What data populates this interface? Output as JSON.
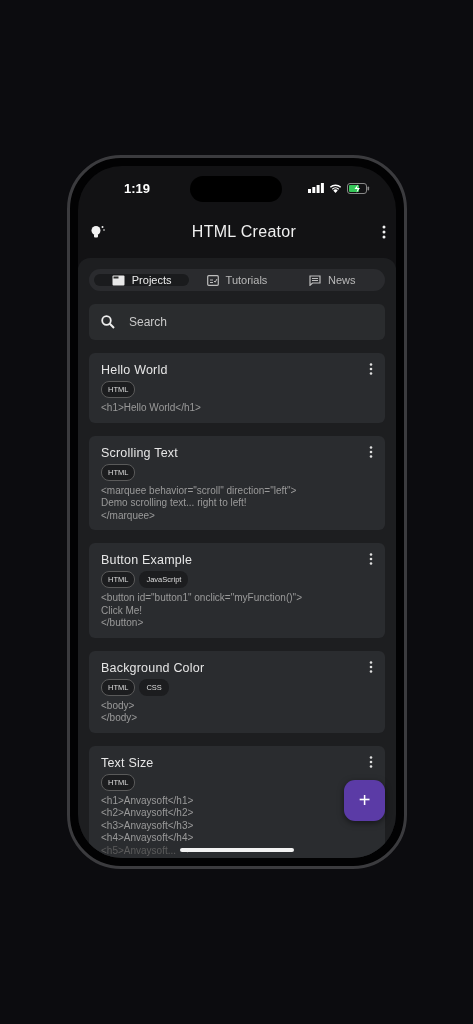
{
  "status_bar": {
    "time": "1:19"
  },
  "app_bar": {
    "title": "HTML Creator"
  },
  "tabs": [
    {
      "label": "Projects",
      "kind": "folder",
      "selected": true
    },
    {
      "label": "Tutorials",
      "kind": "checklist",
      "selected": false
    },
    {
      "label": "News",
      "kind": "chat",
      "selected": false
    }
  ],
  "search": {
    "placeholder": "Search"
  },
  "projects": [
    {
      "title": "Hello World",
      "tags": [
        {
          "label": "HTML",
          "kind": "outlined"
        }
      ],
      "code": [
        "<h1>Hello World</h1>"
      ],
      "truncated": false
    },
    {
      "title": "Scrolling Text",
      "tags": [
        {
          "label": "HTML",
          "kind": "outlined"
        }
      ],
      "code": [
        "<marquee behavior=\"scroll\" direction=\"left\">",
        "Demo scrolling text... right to left!",
        "</marquee>"
      ],
      "truncated": false
    },
    {
      "title": "Button Example",
      "tags": [
        {
          "label": "HTML",
          "kind": "outlined"
        },
        {
          "label": "JavaScript",
          "kind": "filled"
        }
      ],
      "code": [
        "<button id=\"button1\" onclick=\"myFunction()\">",
        "Click Me!",
        "</button>"
      ],
      "truncated": false
    },
    {
      "title": "Background Color",
      "tags": [
        {
          "label": "HTML",
          "kind": "outlined"
        },
        {
          "label": "CSS",
          "kind": "filled"
        }
      ],
      "code": [
        "<body>",
        "</body>"
      ],
      "truncated": false
    },
    {
      "title": "Text Size",
      "tags": [
        {
          "label": "HTML",
          "kind": "outlined"
        }
      ],
      "code": [
        "<h1>Anvaysoft</h1>",
        "<h2>Anvaysoft</h2>",
        "<h3>Anvaysoft</h3>",
        "<h4>Anvaysoft</h4>",
        "<h5>Anvaysoft..."
      ],
      "truncated": true
    }
  ],
  "fab": {
    "label": "+"
  }
}
